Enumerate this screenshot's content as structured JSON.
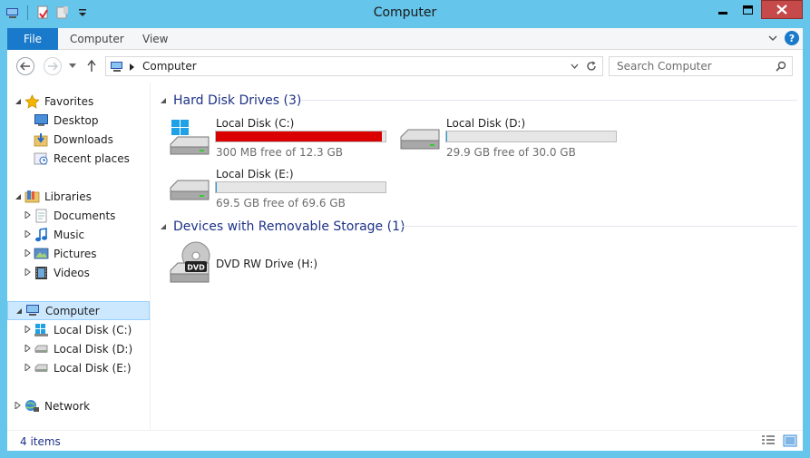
{
  "window": {
    "title": "Computer",
    "accent": "#65c5ea"
  },
  "ribbon": {
    "file": "File",
    "tabs": [
      "Computer",
      "View"
    ]
  },
  "address": {
    "path": "Computer",
    "search_placeholder": "Search Computer"
  },
  "nav": {
    "favorites": "Favorites",
    "desktop": "Desktop",
    "downloads": "Downloads",
    "recent": "Recent places",
    "libraries": "Libraries",
    "documents": "Documents",
    "music": "Music",
    "pictures": "Pictures",
    "videos": "Videos",
    "computer": "Computer",
    "disk_c": "Local Disk (C:)",
    "disk_d": "Local Disk (D:)",
    "disk_e": "Local Disk (E:)",
    "network": "Network"
  },
  "groups": {
    "hdd": "Hard Disk Drives (3)",
    "removable": "Devices with Removable Storage (1)"
  },
  "drives": [
    {
      "name": "Local Disk (C:)",
      "free": "300 MB free of 12.3 GB",
      "used_fraction": 0.976,
      "bar_color": "#da0000"
    },
    {
      "name": "Local Disk (D:)",
      "free": "29.9 GB free of 30.0 GB",
      "used_fraction": 0.003,
      "bar_color": "#26a0da"
    },
    {
      "name": "Local Disk (E:)",
      "free": "69.5 GB free of 69.6 GB",
      "used_fraction": 0.0015,
      "bar_color": "#26a0da"
    }
  ],
  "dvd": {
    "name": "DVD RW Drive (H:)",
    "badge": "DVD"
  },
  "status": {
    "items": "4 items"
  }
}
